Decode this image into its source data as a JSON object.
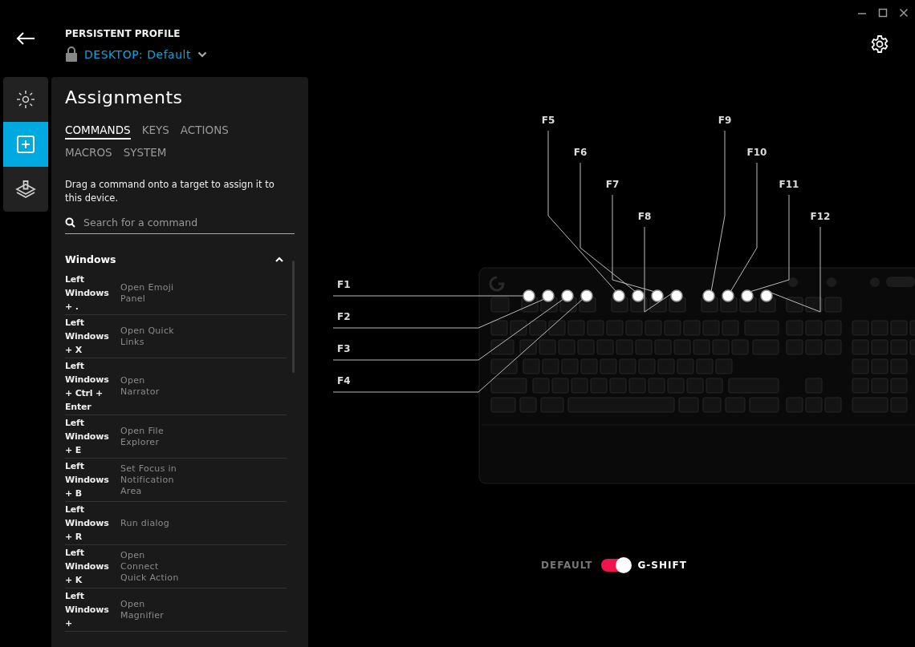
{
  "header": {
    "caption": "PERSISTENT PROFILE",
    "profile_prefix": "DESKTOP:",
    "profile_name": "Default",
    "locked": true
  },
  "nav": [
    {
      "kind": "lighting",
      "selected": false
    },
    {
      "kind": "assignments",
      "selected": true
    },
    {
      "kind": "game",
      "selected": false
    }
  ],
  "panel": {
    "title": "Assignments",
    "tabs": [
      {
        "label": "COMMANDS",
        "selected": true
      },
      {
        "label": "KEYS",
        "selected": false
      },
      {
        "label": "ACTIONS",
        "selected": false
      },
      {
        "label": "MACROS",
        "selected": false
      },
      {
        "label": "SYSTEM",
        "selected": false
      }
    ],
    "description": "Drag a command onto a target to assign it to this device.",
    "search": {
      "placeholder": "Search for a command"
    },
    "section": {
      "title": "Windows",
      "expanded": true,
      "commands": [
        {
          "keys": "Left Windows + .",
          "action": "Open Emoji Panel"
        },
        {
          "keys": "Left Windows + X",
          "action": "Open Quick Links"
        },
        {
          "keys": "Left Windows + Ctrl + Enter",
          "action": "Open Narrator"
        },
        {
          "keys": "Left Windows + E",
          "action": "Open File Explorer"
        },
        {
          "keys": "Left Windows + B",
          "action": "Set Focus in Notification Area"
        },
        {
          "keys": "Left Windows + R",
          "action": "Run dialog"
        },
        {
          "keys": "Left Windows + K",
          "action": "Open Connect Quick Action"
        },
        {
          "keys": "Left Windows +",
          "action": "Open Magnifier"
        }
      ]
    }
  },
  "callouts": [
    {
      "label": "F1"
    },
    {
      "label": "F2"
    },
    {
      "label": "F3"
    },
    {
      "label": "F4"
    },
    {
      "label": "F5"
    },
    {
      "label": "F6"
    },
    {
      "label": "F7"
    },
    {
      "label": "F8"
    },
    {
      "label": "F9"
    },
    {
      "label": "F10"
    },
    {
      "label": "F11"
    },
    {
      "label": "F12"
    }
  ],
  "mode_toggle": {
    "off_label": "DEFAULT",
    "on_label": "G-SHIFT",
    "on": true
  }
}
